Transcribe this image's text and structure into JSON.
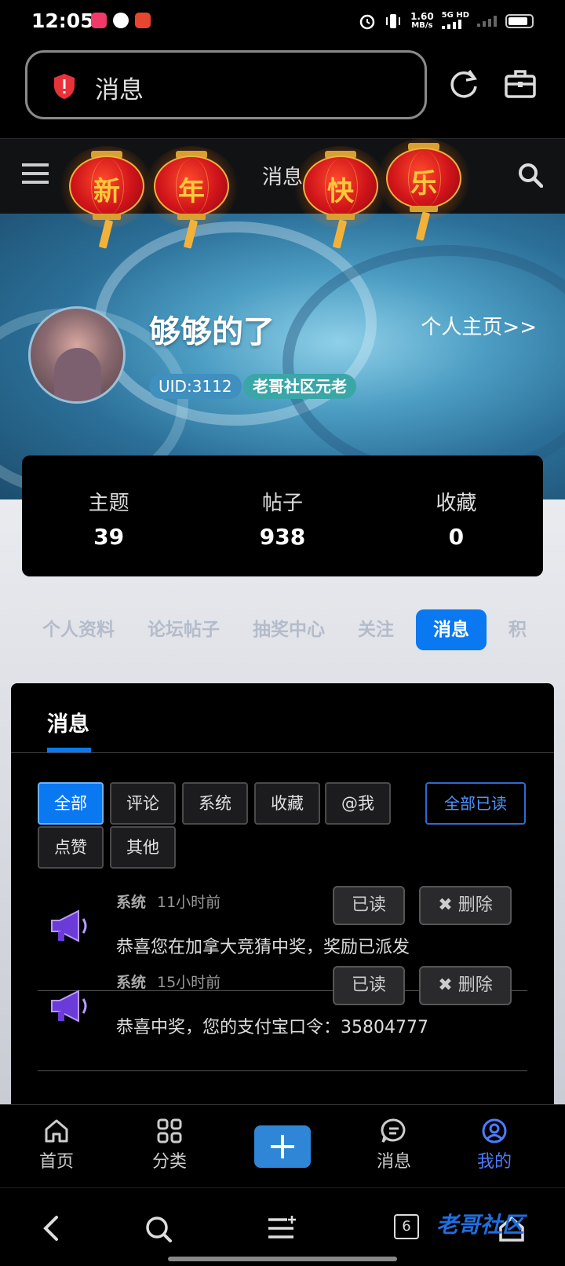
{
  "status_bar": {
    "time": "12:05",
    "speed_top": "1.60",
    "speed_unit": "MB/s",
    "network_top": "5G HD",
    "network_bottom": "",
    "battery_level": 0.85
  },
  "browser": {
    "address_text": "消息"
  },
  "site_header": {
    "title": "消息",
    "lantern_chars": [
      "新",
      "年",
      "快",
      "乐"
    ]
  },
  "profile": {
    "username": "够够的了",
    "home_link": "个人主页>>",
    "uid": "UID:3112",
    "rank": "老哥社区元老"
  },
  "stats": [
    {
      "label": "主题",
      "value": "39"
    },
    {
      "label": "帖子",
      "value": "938"
    },
    {
      "label": "收藏",
      "value": "0"
    }
  ],
  "profile_tabs": [
    "个人资料",
    "论坛帖子",
    "抽奖中心",
    "关注",
    "消息",
    "积"
  ],
  "messages_panel": {
    "title": "消息",
    "filters": [
      "全部",
      "评论",
      "系统",
      "收藏",
      "@我",
      "点赞",
      "其他"
    ],
    "mark_all_read": "全部已读",
    "items": [
      {
        "type": "系统",
        "time": "11小时前",
        "read_label": "已读",
        "delete_label": "✖ 删除",
        "text": "恭喜您在加拿大竞猜中奖，奖励已派发"
      },
      {
        "type": "系统",
        "time": "15小时前",
        "read_label": "已读",
        "delete_label": "✖ 删除",
        "text": "恭喜中奖，您的支付宝口令：35804777"
      }
    ]
  },
  "bottom_nav": [
    {
      "label": "首页",
      "icon": "home-icon"
    },
    {
      "label": "分类",
      "icon": "grid-icon"
    },
    {
      "label": "",
      "icon": "plus-icon"
    },
    {
      "label": "消息",
      "icon": "chat-icon"
    },
    {
      "label": "我的",
      "icon": "user-icon"
    }
  ],
  "system_nav": {
    "tabs_count": "6",
    "watermark": "老哥社区"
  },
  "colors": {
    "accent": "#0a78f0",
    "active_nav": "#4d7cff"
  }
}
